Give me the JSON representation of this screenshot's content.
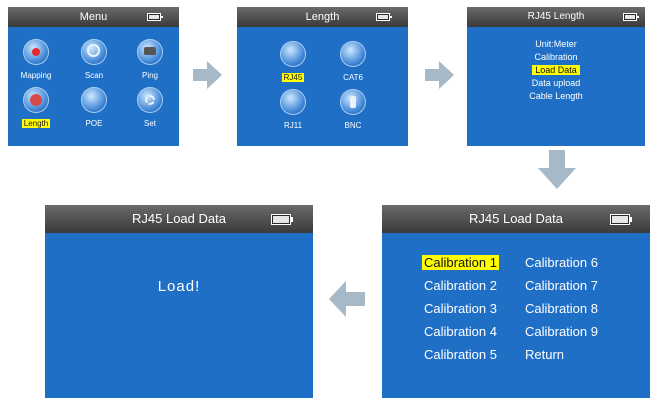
{
  "screens": {
    "menu": {
      "title": "Menu",
      "items": [
        {
          "label": "Mapping",
          "icon": "mapping-icon"
        },
        {
          "label": "Scan",
          "icon": "scan-icon"
        },
        {
          "label": "Ping",
          "icon": "ping-icon"
        },
        {
          "label": "Length",
          "icon": "length-icon",
          "selected": true
        },
        {
          "label": "POE",
          "icon": "poe-icon"
        },
        {
          "label": "Set",
          "icon": "set-icon"
        }
      ]
    },
    "length": {
      "title": "Length",
      "items": [
        {
          "label": "RJ45",
          "icon": "rj45-icon",
          "selected": true
        },
        {
          "label": "CAT6",
          "icon": "cat6-icon"
        },
        {
          "label": "RJ11",
          "icon": "rj11-icon"
        },
        {
          "label": "BNC",
          "icon": "bnc-icon"
        }
      ]
    },
    "rj45_length": {
      "title": "RJ45 Length",
      "items": [
        "Unit:Meter",
        "Calibration",
        "Load Data",
        "Data upload",
        "Cable Length"
      ],
      "selected_index": 2
    },
    "load_data": {
      "title": "RJ45  Load Data",
      "col1": [
        "Calibration 1",
        "Calibration 2",
        "Calibration 3",
        "Calibration 4",
        "Calibration 5"
      ],
      "col2": [
        "Calibration 6",
        "Calibration 7",
        "Calibration 8",
        "Calibration 9",
        "Return"
      ],
      "selected": "Calibration 1"
    },
    "load_result": {
      "title": "RJ45  Load Data",
      "message": "Load!"
    }
  },
  "colors": {
    "screen_bg": "#1f6fc7",
    "highlight": "#ffff00",
    "arrow": "#a7b8c6"
  }
}
